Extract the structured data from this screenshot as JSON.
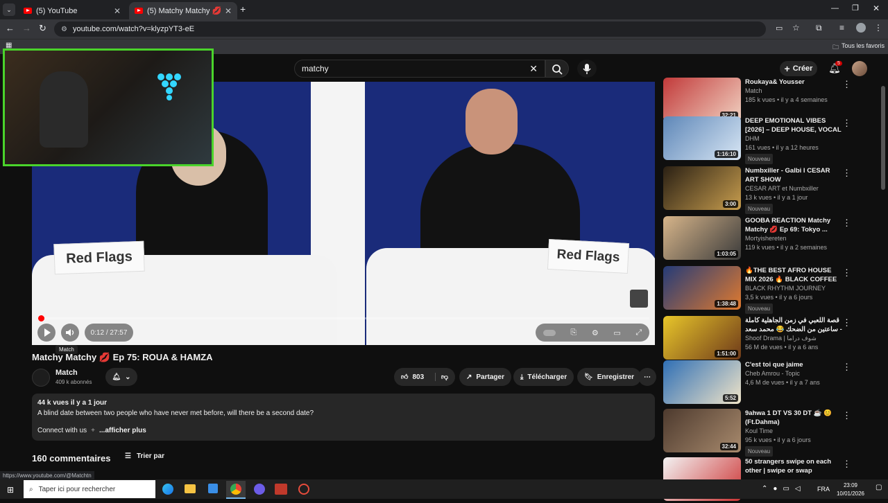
{
  "browser": {
    "tabs": [
      {
        "title": "(5) YouTube",
        "active": false
      },
      {
        "title": "(5) Matchy Matchy 💋 Ep 75: R",
        "active": true
      }
    ],
    "url": "youtube.com/watch?v=klyzpYT3-eE",
    "bookmarks_label": "Tous les favoris",
    "status_url": "https://www.youtube.com/@Matchtn"
  },
  "header": {
    "search_query": "matchy",
    "create_label": "Créer",
    "notif_count": "5"
  },
  "player": {
    "time": "0:12 / 27:57",
    "tooltip": "Match",
    "progress_fraction": 0.0072,
    "sign_left": "Red Flags",
    "sign_right": "Red Flags"
  },
  "video": {
    "title": "Matchy Matchy 💋 Ep 75: ROUA & HAMZA",
    "channel": "Match",
    "subscribers": "409 k abonnés",
    "likes": "803",
    "share": "Partager",
    "download": "Télécharger",
    "save": "Enregistrer",
    "views_date": "44 k vues  il y a 1 jour",
    "description": "A blind date between two people who have never met before, will there be a second date?",
    "connect": "Connect with us",
    "more": "...afficher plus",
    "comments_count": "160 commentaires",
    "sort": "Trier par"
  },
  "sidebar": [
    {
      "title": "Roukaya& Yousser",
      "channel": "Match",
      "stats": "185 k vues • il y a 4 semaines",
      "duration": "32:21",
      "badge": ""
    },
    {
      "title": "DEEP EMOTIONAL VIBES [2026] – DEEP HOUSE, VOCAL HOUS...",
      "channel": "DHM",
      "stats": "161 vues • il y a 12 heures",
      "duration": "1:16:10",
      "badge": "Nouveau"
    },
    {
      "title": "Numbxiller - Galbi l CESAR ART SHOW",
      "channel": "CESAR ART et Numbxiller",
      "stats": "13 k vues • il y a 1 jour",
      "duration": "3:00",
      "badge": "Nouveau"
    },
    {
      "title": "GOOBA REACTION Matchy Matchy 💋 Ep 69: Tokyo ...",
      "channel": "Mortyishereten",
      "stats": "119 k vues • il y a 2 semaines",
      "duration": "1:03:05",
      "badge": ""
    },
    {
      "title": "🔥THE BEST AFRO HOUSE MIX 2026 🔥 BLACK COFFEE",
      "channel": "BLACK RHYTHM JOURNEY",
      "stats": "3,5 k vues • il y a 6 jours",
      "duration": "1:38:48",
      "badge": "Nouveau"
    },
    {
      "title": "قصة اللعبي في زمن الجاهلية كاملة - ساعتين من الضحك 😂 محمد سعد - فيلم اللمبي",
      "channel": "Shoof Drama | شوف دراما",
      "stats": "56 M de vues • il y a 6 ans",
      "duration": "1:51:00",
      "badge": ""
    },
    {
      "title": "C'est toi que jaime",
      "channel": "Cheb Amrou - Topic",
      "stats": "4,6 M de vues • il y a 7 ans",
      "duration": "5:52",
      "badge": ""
    },
    {
      "title": "9ahwa 1 DT VS 30 DT ☕ 😊 (Ft.Dahma)",
      "channel": "Koul Time",
      "stats": "95 k vues • il y a 6 jours",
      "duration": "32:44",
      "badge": "Nouveau"
    },
    {
      "title": "50 strangers swipe on each other | swipe or swap",
      "channel": "",
      "stats": "",
      "duration": "",
      "badge": ""
    }
  ],
  "taskbar": {
    "search_placeholder": "Taper ici pour rechercher",
    "lang": "FRA",
    "time": "23:09",
    "date": "10/01/2026"
  },
  "colors": {
    "accent": "#ff0000",
    "pip_border": "#4ad42b"
  }
}
